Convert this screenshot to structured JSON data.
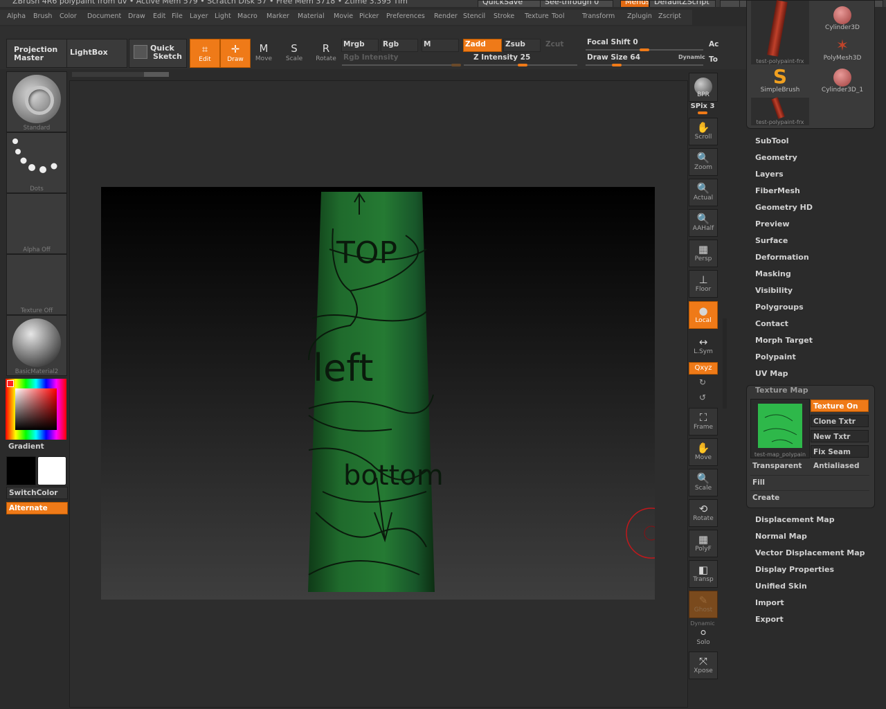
{
  "titlebar": {
    "left_text": "ZBrush 4R6   polypaint from uv   • Active Mem 579 • Scratch Disk 57 • Free Mem 3718 • Ztime 3.395  Tim",
    "quicksave": "QuickSave",
    "see_through": "See-through   0",
    "menus": "Menus",
    "default_zscript": "DefaultZScript"
  },
  "menubar": [
    "Alpha",
    "Brush",
    "Color",
    "Document",
    "Draw",
    "Edit",
    "File",
    "Layer",
    "Light",
    "Macro",
    "Marker",
    "Material",
    "Movie",
    "Picker",
    "Preferences",
    "Render",
    "Stencil",
    "Stroke",
    "Texture",
    "Tool",
    "Transform",
    "Zplugin",
    "Zscript"
  ],
  "shelf": {
    "projection_master": [
      "Projection",
      "Master"
    ],
    "lightbox": "LightBox",
    "quick_sketch": [
      "Quick",
      "Sketch"
    ],
    "edit": "Edit",
    "draw": "Draw",
    "move": "Move",
    "scale": "Scale",
    "rotate": "Rotate",
    "mrgb": "Mrgb",
    "rgb": "Rgb",
    "m": "M",
    "rgb_intensity": "Rgb Intensity",
    "zadd": "Zadd",
    "zsub": "Zsub",
    "zcut": "Zcut",
    "z_intensity": "Z Intensity 25",
    "focal_shift": "Focal Shift 0",
    "draw_size": "Draw Size 64",
    "dynamic": "Dynamic",
    "ac": "Ac",
    "to": "To"
  },
  "left": {
    "brush": "Standard",
    "stroke": "Dots",
    "alpha": "Alpha Off",
    "texture": "Texture Off",
    "material": "BasicMaterial2",
    "gradient": "Gradient",
    "switchcolor": "SwitchColor",
    "alternate": "Alternate"
  },
  "right_tools": {
    "bpr": "BPR",
    "spix": "SPix 3",
    "scroll": "Scroll",
    "zoom": "Zoom",
    "actual": "Actual",
    "aahalf": "AAHalf",
    "persp": "Persp",
    "floor": "Floor",
    "local": "Local",
    "lsym": "L.Sym",
    "xyz": "Qxyz",
    "frame": "Frame",
    "move": "Move",
    "scale": "Scale",
    "rotate": "Rotate",
    "polyf": "PolyF",
    "transp": "Transp",
    "ghost": "Ghost",
    "dynamic": "Dynamic",
    "solo": "Solo",
    "xpose": "Xpose"
  },
  "tool_palette": {
    "items": [
      "test-polypaint-frx",
      "Cylinder3D",
      "PolyMesh3D",
      "SimpleBrush",
      "Cylinder3D_1",
      "test-polypaint-frx"
    ]
  },
  "subpalettes": [
    "SubTool",
    "Geometry",
    "Layers",
    "FiberMesh",
    "Geometry HD",
    "Preview",
    "Surface",
    "Deformation",
    "Masking",
    "Visibility",
    "Polygroups",
    "Contact",
    "Morph Target",
    "Polypaint",
    "UV Map"
  ],
  "texture_map": {
    "title": "Texture Map",
    "thumb_caption": "test-map_polypain",
    "texture_on": "Texture On",
    "clone_txtr": "Clone Txtr",
    "new_txtr": "New Txtr",
    "fix_seam": "Fix Seam",
    "transparent": "Transparent",
    "antialiased": "Antialiased",
    "fill": "Fill",
    "create": "Create"
  },
  "subpalettes_after": [
    "Displacement Map",
    "Normal Map",
    "Vector Displacement Map",
    "Display Properties",
    "Unified Skin",
    "Import",
    "Export"
  ],
  "canvas": {
    "annotations": [
      "TOP",
      "left",
      "bottom"
    ]
  },
  "colors": {
    "accent": "#ef7a18",
    "model_green": "#1f6a2c",
    "cursor_red": "#c0181c"
  }
}
